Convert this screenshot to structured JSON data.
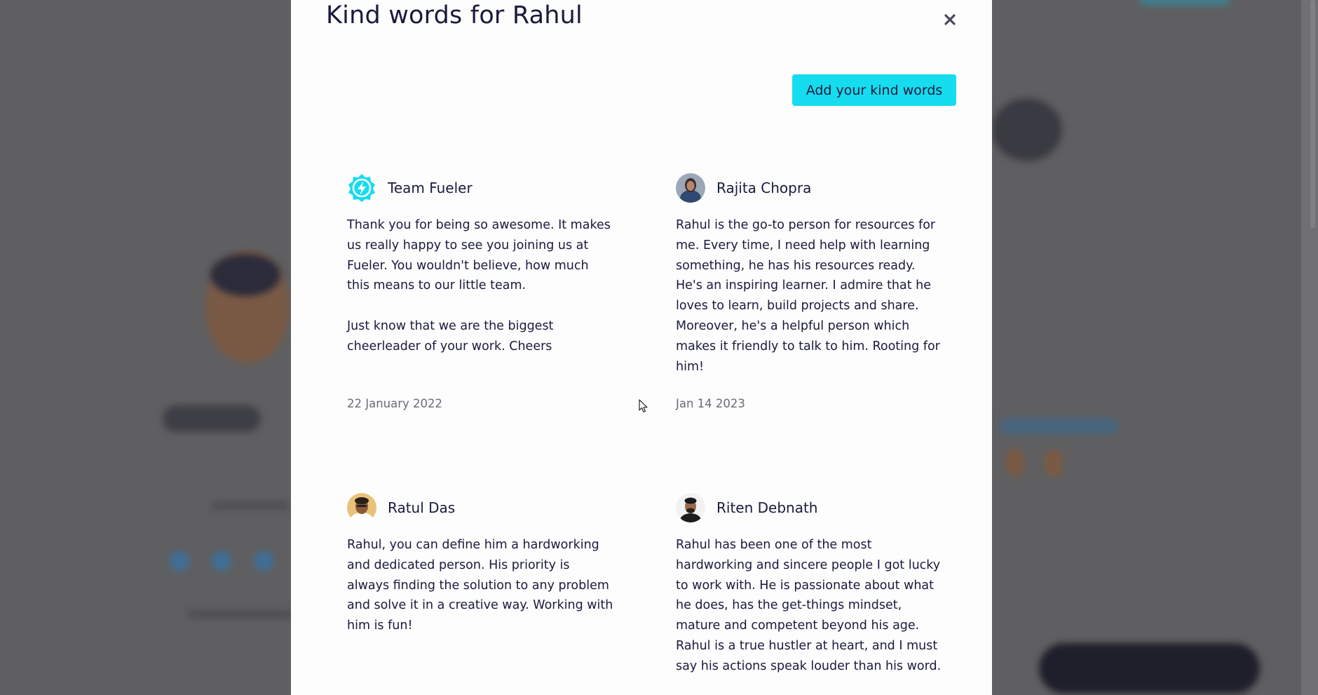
{
  "colors": {
    "overlay": "#5f5f61",
    "modal_bg": "#fdfdfd",
    "accent": "#16dcef",
    "text": "#1a1a3d",
    "muted": "#6a6a76"
  },
  "modal": {
    "title": "Kind words for Rahul",
    "close_icon": "close-icon",
    "add_button_label": "Add your kind words"
  },
  "testimonials": [
    {
      "author": "Team Fueler",
      "avatar_icon": "lightning-badge-icon",
      "paragraphs": [
        "Thank you for being so awesome. It makes us really happy to see you joining us at Fueler. You wouldn't believe, how much this means to our little team.",
        "Just know that we are the biggest cheerleader of your work. Cheers"
      ],
      "date": "22 January 2022"
    },
    {
      "author": "Rajita Chopra",
      "avatar_icon": "user-avatar",
      "paragraphs": [
        "Rahul is the go-to person for resources for me. Every time, I need help with learning something, he has his resources ready. He's an inspiring learner. I admire that he loves to learn, build projects and share. Moreover, he's a helpful person which makes it friendly to talk to him. Rooting for him!"
      ],
      "date": "Jan 14 2023"
    },
    {
      "author": "Ratul Das",
      "avatar_icon": "user-avatar",
      "paragraphs": [
        "Rahul, you can define him a hardworking and dedicated person. His priority is always finding the solution to any problem and solve it in a creative way. Working with him is fun!"
      ]
    },
    {
      "author": "Riten Debnath",
      "avatar_icon": "user-avatar",
      "paragraphs": [
        "Rahul has been one of the most hardworking and sincere people I got lucky to work with. He is passionate about what he does, has the get-things mindset, mature and competent beyond his age. Rahul is a true hustler at heart, and I must say his actions speak louder than his word."
      ]
    }
  ]
}
